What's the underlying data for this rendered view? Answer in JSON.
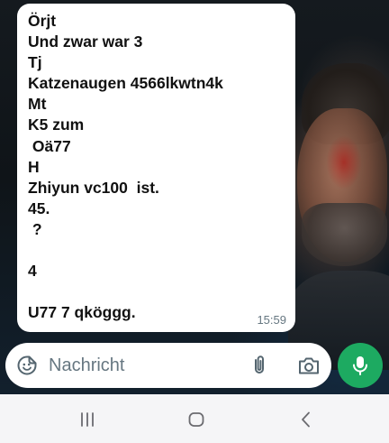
{
  "message": {
    "lines": [
      "Örjt",
      "Und zwar war 3",
      "Tj",
      "Katzenaugen 4566lkwtn4k",
      "Mt",
      "K5 zum",
      " Oä77",
      "H",
      "Zhiyun vc100  ist.",
      "45.",
      " ?",
      "",
      "4",
      "",
      "U77 7 qköggg."
    ],
    "time": "15:59"
  },
  "composer": {
    "placeholder": "Nachricht",
    "emoji_icon": "sticker-emoji-icon",
    "attach_icon": "paperclip-icon",
    "camera_icon": "camera-icon",
    "mic_icon": "microphone-icon"
  },
  "colors": {
    "bubble": "#ffffff",
    "text": "#111111",
    "meta": "#667781",
    "accent": "#1daa61",
    "navbar": "#f5f5f7"
  },
  "navigation": {
    "recents_icon": "recent-apps-icon",
    "home_icon": "home-icon",
    "back_icon": "back-icon"
  }
}
